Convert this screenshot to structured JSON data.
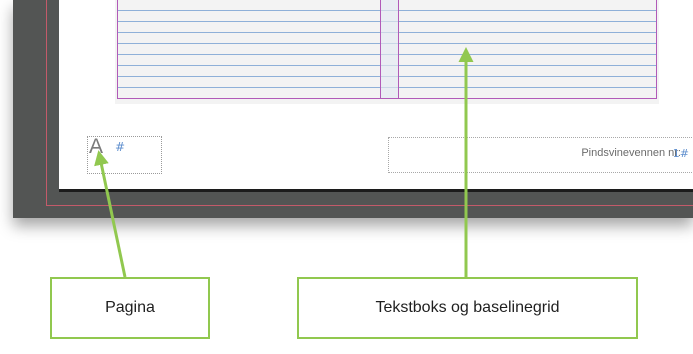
{
  "page_number": {
    "master_prefix": "A",
    "marker": "#"
  },
  "footer": {
    "text": "Pindsvinevennen nr:",
    "marker": "1#"
  },
  "callouts": {
    "pagina": "Pagina",
    "tekstboks": "Tekstboks og baselinegrid"
  },
  "colors": {
    "callout_border": "#91c84f",
    "arrow": "#91c84f",
    "margin_guide": "#b15ab8",
    "baseline_grid": "#8fb0d8",
    "bleed_guide": "#c35a6a",
    "pasteboard": "#535554"
  }
}
